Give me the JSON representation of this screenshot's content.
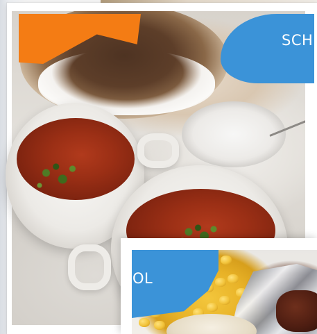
{
  "collage": {
    "card_1": {
      "photo_subject": "soup-bowls-and-bread",
      "banner_color": "#f47c14",
      "label_color": "#3b93d8",
      "label_text": "SCH"
    },
    "card_2": {
      "photo_subject": "corn-and-grilled-meat-in-foil",
      "label_color": "#3b93d8",
      "label_text": "OL"
    }
  }
}
